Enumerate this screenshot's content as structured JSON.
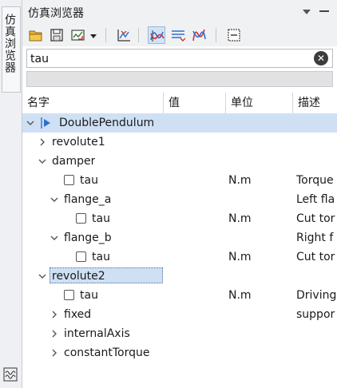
{
  "sidetab": {
    "label": "仿真浏览器",
    "icon": "variable-browser-icon"
  },
  "panel": {
    "title": "仿真浏览器",
    "menu_icon": "dropdown-triangle-icon",
    "minimize_icon": "minimize-icon"
  },
  "toolbar": {
    "buttons": [
      {
        "name": "open-folder-icon",
        "active": false
      },
      {
        "name": "save-icon",
        "active": false
      },
      {
        "name": "export-plot-icon",
        "active": false
      },
      {
        "name": "dropdown-arrow-icon",
        "active": false
      },
      {
        "name": "plot-variable-icon",
        "active": false
      },
      {
        "name": "curve-mode-icon",
        "active": true
      },
      {
        "name": "list-mode-icon",
        "active": false
      },
      {
        "name": "parametric-curve-icon",
        "active": false
      },
      {
        "name": "window-minimize-icon",
        "active": false
      }
    ]
  },
  "search": {
    "value": "tau",
    "clear_icon": "clear-search-icon"
  },
  "header": {
    "name": "名字",
    "value": "值",
    "unit": "单位",
    "description": "描述"
  },
  "tree": [
    {
      "level": 0,
      "label": "DoublePendulum",
      "expanded": true,
      "model": true,
      "selected": true
    },
    {
      "level": 1,
      "label": "revolute1",
      "expanded": false
    },
    {
      "level": 1,
      "label": "damper",
      "expanded": true
    },
    {
      "level": 2,
      "label": "tau",
      "checkbox": true,
      "unit": "N.m",
      "desc": "Torque"
    },
    {
      "level": 2,
      "label": "flange_a",
      "expanded": true,
      "desc": "Left fla"
    },
    {
      "level": 3,
      "label": "tau",
      "checkbox": true,
      "unit": "N.m",
      "desc": "Cut tor"
    },
    {
      "level": 2,
      "label": "flange_b",
      "expanded": true,
      "desc": "Right f"
    },
    {
      "level": 3,
      "label": "tau",
      "checkbox": true,
      "unit": "N.m",
      "desc": "Cut tor"
    },
    {
      "level": 1,
      "label": "revolute2",
      "expanded": true,
      "selected": true,
      "focused": true
    },
    {
      "level": 2,
      "label": "tau",
      "checkbox": true,
      "unit": "N.m",
      "desc": "Driving"
    },
    {
      "level": 2,
      "label": "fixed",
      "expanded": false,
      "desc": "suppor"
    },
    {
      "level": 2,
      "label": "internalAxis",
      "expanded": false
    },
    {
      "level": 2,
      "label": "constantTorque",
      "expanded": false
    }
  ]
}
